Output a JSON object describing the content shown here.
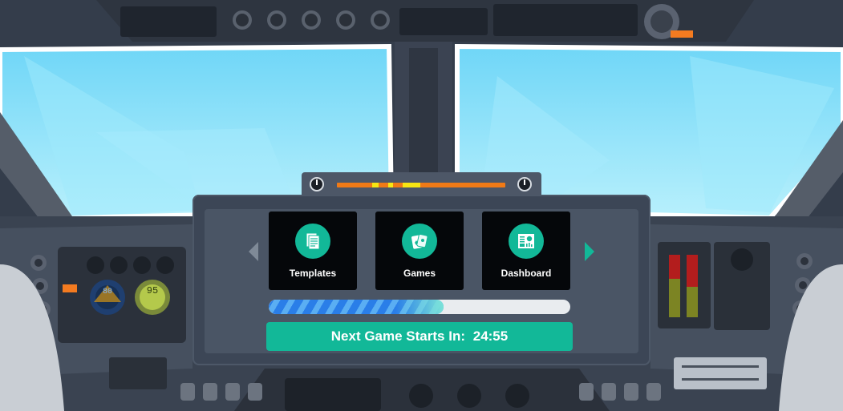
{
  "menu": {
    "tiles": [
      {
        "label": "Templates",
        "icon": "templates-icon"
      },
      {
        "label": "Games",
        "icon": "games-icon"
      },
      {
        "label": "Dashboard",
        "icon": "dashboard-icon"
      }
    ],
    "prev_icon": "chevron-left-icon",
    "next_icon": "chevron-right-icon"
  },
  "progress": {
    "fraction": 0.58
  },
  "countdown": {
    "label": "Next Game Starts In:",
    "time": "24:55"
  },
  "gauges": {
    "left_value": "80",
    "right_value": "95"
  },
  "colors": {
    "accent": "#12b898",
    "progress_blue": "#2a7ee8",
    "arrow_inactive": "#7f8a97",
    "arrow_active": "#12b898",
    "header_bar": "#f07a16",
    "header_bar_highlight": "#f7e613",
    "sky": "#8fe3fb"
  }
}
